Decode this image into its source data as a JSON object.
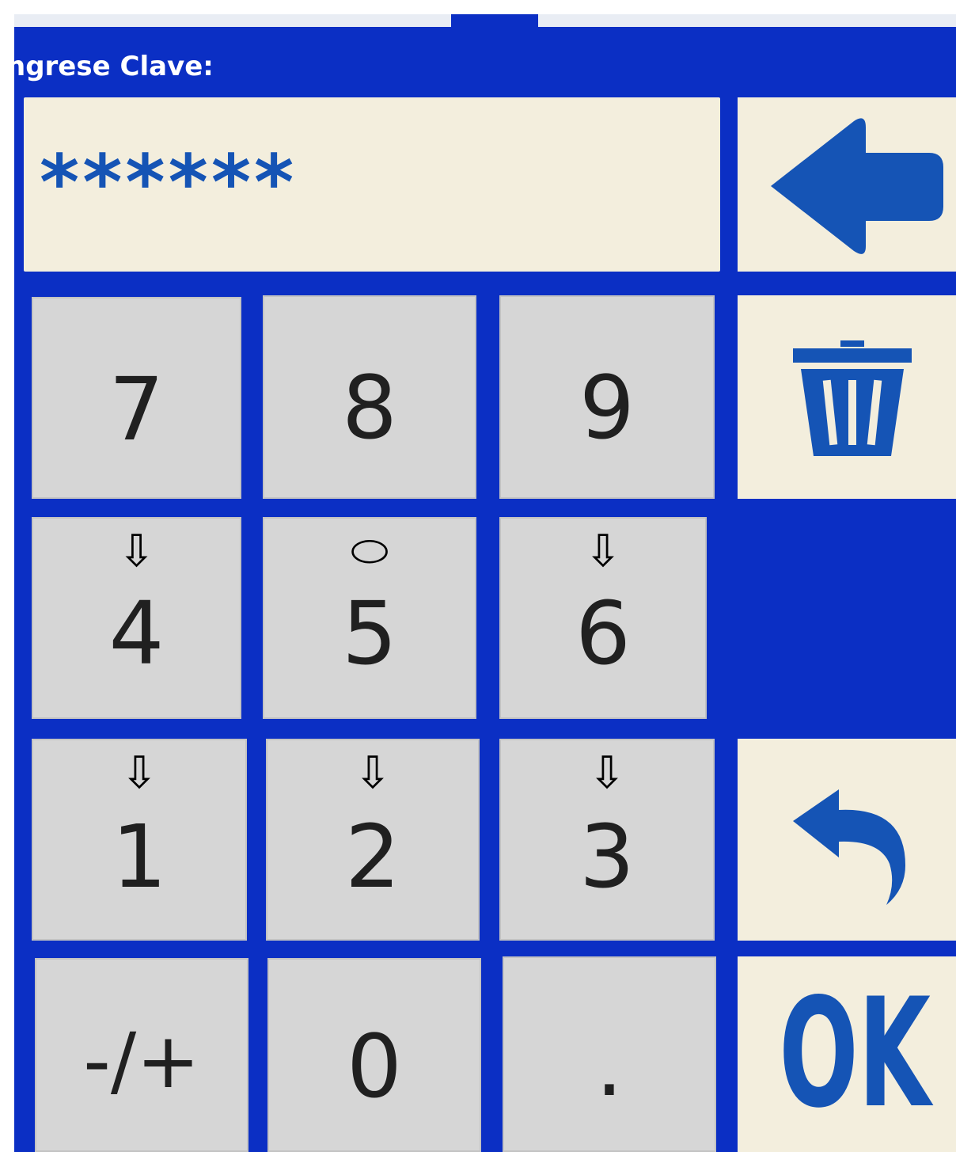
{
  "keypad": {
    "prompt": "ngrese Clave:",
    "password_value": "******",
    "keys": {
      "k7": "7",
      "k8": "8",
      "k9": "9",
      "k4": "4",
      "k5": "5",
      "k6": "6",
      "k1": "1",
      "k2": "2",
      "k3": "3",
      "sign": "-/+",
      "k0": "0",
      "dot": "."
    },
    "arrows": {
      "a4": "⇩",
      "a5": "⬭",
      "a6": "⇩",
      "a1": "⇩",
      "a2": "⇩",
      "a3": "⇩"
    },
    "ok_label": "OK"
  },
  "colors": {
    "background": "#0b2fc4",
    "key_face": "#d6d6d6",
    "function_key_face": "#f3eedd",
    "accent": "#1554b5"
  },
  "icons": {
    "backspace": "left-arrow-icon",
    "clear": "trash-icon",
    "undo": "undo-icon"
  }
}
